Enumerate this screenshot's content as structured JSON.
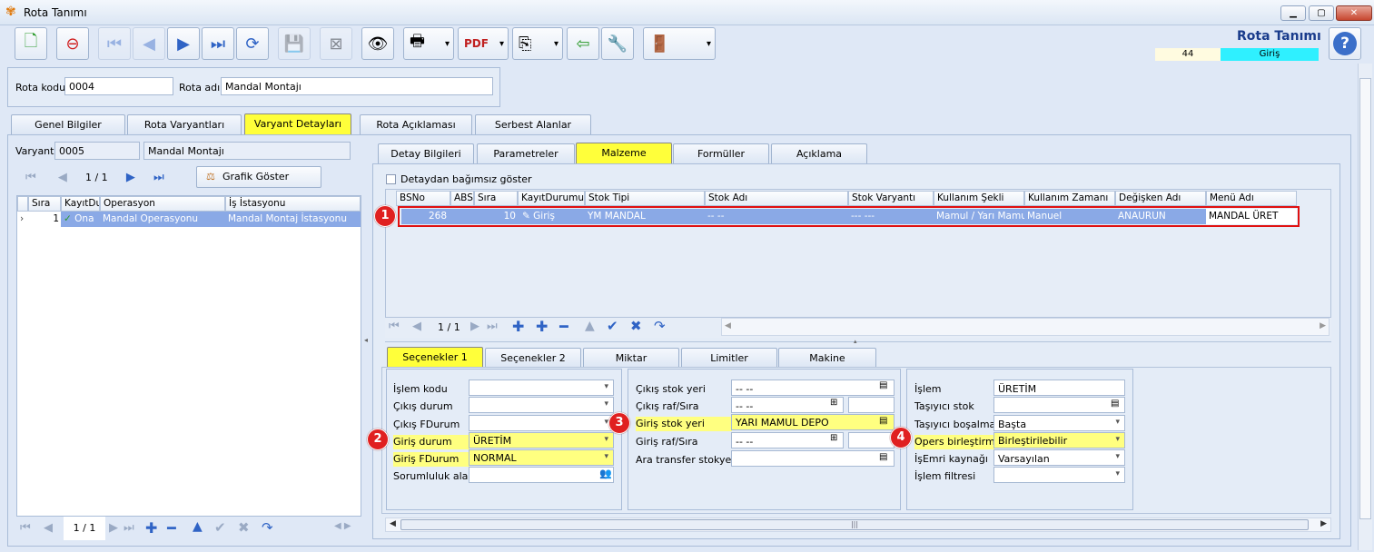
{
  "window": {
    "title": "Rota Tanımı",
    "app_icon": "butterfly-icon",
    "controls": [
      "minimize",
      "maximize",
      "close"
    ]
  },
  "header": {
    "title": "Rota Tanımı",
    "record_no": "44",
    "mode": "Giriş",
    "help_icon": "help-icon",
    "colors": {
      "title": "#1a3c8c",
      "mode_bg": "#2ff0ff"
    }
  },
  "form": {
    "rota_kodu_label": "Rota kodu",
    "rota_kodu": "0004",
    "rota_adi_label": "Rota adı",
    "rota_adi": "Mandal Montajı"
  },
  "main_tabs": [
    "Genel Bilgiler",
    "Rota Varyantları",
    "Varyant Detayları",
    "Rota Açıklaması",
    "Serbest Alanlar"
  ],
  "active_main_tab": "Varyant Detayları",
  "left": {
    "varyant_label": "Varyant",
    "varyant_code": "0005",
    "varyant_name": "Mandal Montajı",
    "page": "1 / 1",
    "graph_button": "Grafik Göster",
    "columns": [
      "Sıra",
      "KayıtDurumu",
      "Operasyon",
      "İş İstasyonu"
    ],
    "columns_short": [
      "Sıra",
      "KayıtDu"
    ],
    "rows": [
      {
        "sira": "1",
        "durum": "Ona",
        "operasyon": "Mandal Operasyonu",
        "istasyon": "Mandal Montaj İstasyonu"
      }
    ],
    "bottom_page": "1 / 1"
  },
  "detail_tabs": [
    "Detay Bilgileri",
    "Parametreler",
    "Malzeme",
    "Formüller",
    "Açıklama"
  ],
  "active_detail_tab": "Malzeme",
  "independent_label": "Detaydan bağımsız göster",
  "mat_grid": {
    "columns": [
      "BSNo",
      "ABSN",
      "Sıra",
      "KayıtDurumu",
      "Stok Tipi",
      "Stok Adı",
      "Stok Varyantı",
      "Kullanım Şekli",
      "Kullanım Zamanı",
      "Değişken Adı",
      "Menü Adı"
    ],
    "row": {
      "bsno": "268",
      "sira": "10",
      "durum": "Giriş",
      "stok_tipi": "YM MANDAL",
      "stok_adi": "-- --",
      "varyant": "--- ---",
      "kullanim_sekli": "Mamul / Yarı Mamul",
      "kullanim_zamani": "Manuel",
      "degisken": "ANAURUN",
      "menu": "MANDAL ÜRET"
    },
    "page": "1 / 1"
  },
  "option_tabs": [
    "Seçenekler 1",
    "Seçenekler 2",
    "Miktar",
    "Limitler",
    "Makine"
  ],
  "active_option_tab": "Seçenekler 1",
  "opts1": {
    "islem_kodu": {
      "label": "İşlem kodu",
      "value": ""
    },
    "cikis_durum": {
      "label": "Çıkış durum",
      "value": ""
    },
    "cikis_fdurum": {
      "label": "Çıkış FDurum",
      "value": ""
    },
    "giris_durum": {
      "label": "Giriş durum",
      "value": "ÜRETİM"
    },
    "giris_fdurum": {
      "label": "Giriş FDurum",
      "value": "NORMAL"
    },
    "sorumluluk": {
      "label": "Sorumluluk alanı",
      "value": ""
    }
  },
  "opts2": {
    "cikis_stok": {
      "label": "Çıkış stok yeri",
      "value": "-- --"
    },
    "cikis_raf": {
      "label": "Çıkış raf/Sıra",
      "value": "-- --"
    },
    "giris_stok": {
      "label": "Giriş stok yeri",
      "value": "YARI MAMUL DEPO"
    },
    "giris_raf": {
      "label": "Giriş raf/Sıra",
      "value": "-- --"
    },
    "ara_transfer": {
      "label": "Ara transfer stokyeri",
      "value": ""
    }
  },
  "opts3": {
    "islem": {
      "label": "İşlem",
      "value": "ÜRETİM"
    },
    "tasiyici_stok": {
      "label": "Taşıyıcı stok",
      "value": ""
    },
    "tasiyici_bosalma": {
      "label": "Taşıyıcı boşalma",
      "value": "Başta"
    },
    "opers": {
      "label": "Opers birleştirme",
      "value": "Birleştirilebilir"
    },
    "isemri": {
      "label": "İşEmri kaynağı",
      "value": "Varsayılan"
    },
    "islem_filtresi": {
      "label": "İşlem filtresi",
      "value": ""
    }
  },
  "badges": [
    "1",
    "2",
    "3",
    "4"
  ]
}
